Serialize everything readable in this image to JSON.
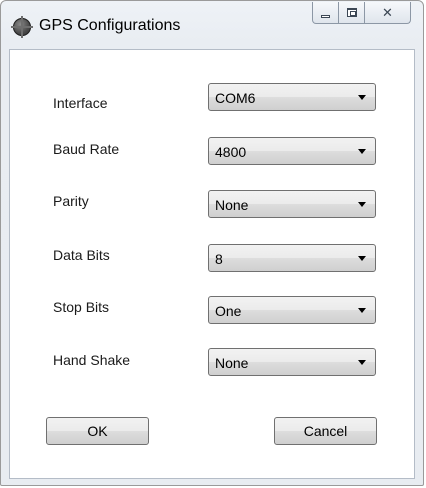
{
  "window": {
    "title": "GPS Configurations",
    "app_icon": "globe-icon",
    "controls": {
      "minimize_icon": "minimize-icon",
      "maximize_icon": "maximize-icon",
      "close_icon": "close-icon",
      "close_glyph": "✕"
    }
  },
  "form": {
    "fields": [
      {
        "label": "Interface",
        "value": "COM6"
      },
      {
        "label": "Baud Rate",
        "value": "4800"
      },
      {
        "label": "Parity",
        "value": "None"
      },
      {
        "label": "Data Bits",
        "value": "8"
      },
      {
        "label": "Stop Bits",
        "value": "One"
      },
      {
        "label": "Hand Shake",
        "value": "None"
      }
    ]
  },
  "buttons": {
    "ok_label": "OK",
    "cancel_label": "Cancel"
  }
}
